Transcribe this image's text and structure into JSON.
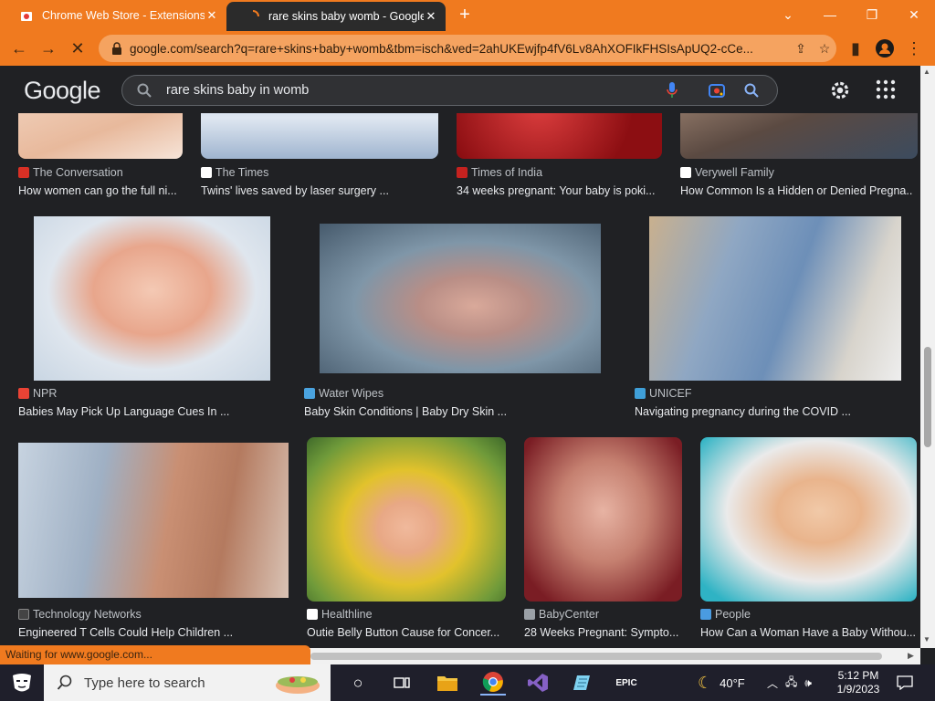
{
  "browser": {
    "tabs": [
      {
        "title": "Chrome Web Store - Extensions"
      },
      {
        "title": "rare skins baby womb - Google S"
      }
    ],
    "url": "google.com/search?q=rare+skins+baby+womb&tbm=isch&ved=2ahUKEwjfp4fV6Lv8AhXOFIkFHSIsApUQ2-cCe...",
    "status": "Waiting for www.google.com..."
  },
  "google": {
    "logo": "Google",
    "query": "rare skins baby in womb"
  },
  "results": {
    "row_top": [
      {
        "source": "The Conversation",
        "caption": "How women can go the full ni..."
      },
      {
        "source": "The Times",
        "caption": "Twins' lives saved by laser surgery ..."
      },
      {
        "source": "Times of India",
        "caption": "34 weeks pregnant: Your baby is poki..."
      },
      {
        "source": "Verywell Family",
        "caption": "How Common Is a Hidden or Denied Pregna..."
      }
    ],
    "row_mid": [
      {
        "source": "NPR",
        "caption": "Babies May Pick Up Language Cues In ..."
      },
      {
        "source": "Water Wipes",
        "caption": "Baby Skin Conditions | Baby Dry Skin ..."
      },
      {
        "source": "UNICEF",
        "caption": "Navigating pregnancy during the COVID ..."
      }
    ],
    "row_bot": [
      {
        "source": "Technology Networks",
        "caption": "Engineered T Cells Could Help Children ..."
      },
      {
        "source": "Healthline",
        "caption": "Outie Belly Button Cause for Concer..."
      },
      {
        "source": "BabyCenter",
        "caption": "28 Weeks Pregnant: Sympto..."
      },
      {
        "source": "People",
        "caption": "How Can a Woman Have a Baby Withou..."
      }
    ]
  },
  "taskbar": {
    "search_placeholder": "Type here to search",
    "weather": "40°F",
    "time": "5:12 PM",
    "date": "1/9/2023"
  },
  "colors": {
    "chrome_orange": "#f07a1f",
    "page_bg": "#202124"
  }
}
